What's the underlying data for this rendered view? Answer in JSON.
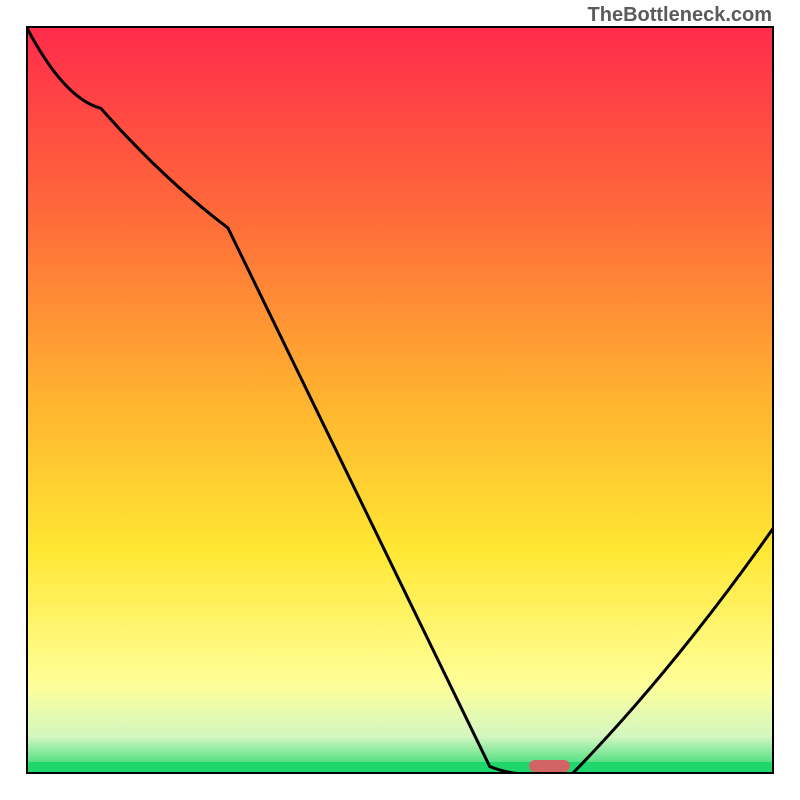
{
  "watermark": "TheBottleneck.com",
  "colors": {
    "grad_top": "#ff2b4c",
    "grad_mid1": "#ff6a3a",
    "grad_mid2": "#ffb330",
    "grad_mid3": "#ffe733",
    "grad_lowyellow": "#ffff99",
    "grad_palegreen": "#d2f7c0",
    "grad_green": "#1fd66a",
    "marker": "#d26466",
    "curve": "#000000",
    "border": "#000000",
    "watermark": "#5b5b5b"
  },
  "plot": {
    "x_range": [
      0,
      100
    ],
    "y_range": [
      0,
      100
    ]
  },
  "chart_data": {
    "type": "line",
    "title": "",
    "xlabel": "",
    "ylabel": "",
    "xlim": [
      0,
      100
    ],
    "ylim": [
      0,
      100
    ],
    "series": [
      {
        "name": "curve",
        "x": [
          0,
          10,
          27,
          62,
          67,
          73,
          100
        ],
        "y": [
          100,
          89,
          73,
          1,
          0,
          0,
          33
        ]
      }
    ],
    "marker": {
      "x": 70,
      "y": 0,
      "width_pct": 5.5,
      "height_pct": 1.6
    },
    "background_gradient": {
      "stops": [
        {
          "pos": 0.0,
          "color": "#ff2b4c"
        },
        {
          "pos": 0.25,
          "color": "#ff6a3a"
        },
        {
          "pos": 0.5,
          "color": "#ffb330"
        },
        {
          "pos": 0.7,
          "color": "#ffe733"
        },
        {
          "pos": 0.88,
          "color": "#ffff99"
        },
        {
          "pos": 0.95,
          "color": "#d2f7c0"
        },
        {
          "pos": 1.0,
          "color": "#1fd66a"
        }
      ]
    }
  }
}
